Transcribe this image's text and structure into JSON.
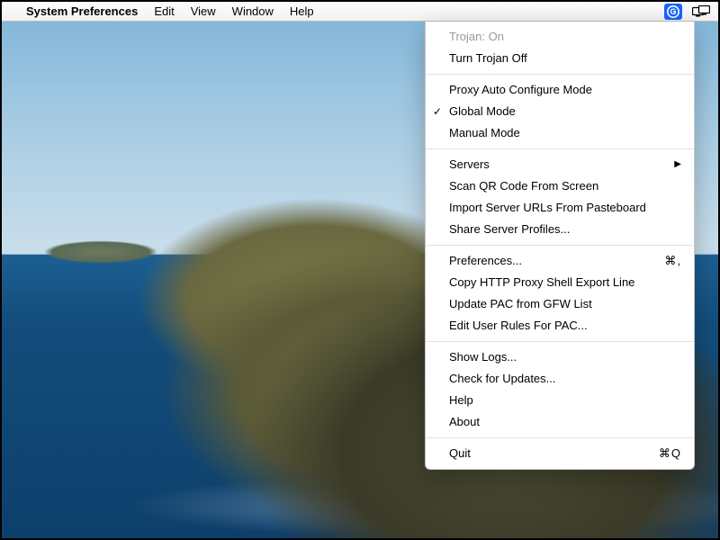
{
  "menubar": {
    "app": "System Preferences",
    "items": [
      "Edit",
      "View",
      "Window",
      "Help"
    ]
  },
  "status_icons": {
    "g_icon": "G",
    "display_icon": "display-mirror"
  },
  "dropdown": {
    "status_label": "Trojan: On",
    "toggle_label": "Turn Trojan Off",
    "modes": {
      "auto": "Proxy Auto Configure Mode",
      "global": "Global Mode",
      "manual": "Manual Mode",
      "selected": "global"
    },
    "servers_label": "Servers",
    "scan_qr": "Scan QR Code From Screen",
    "import_urls": "Import Server URLs From Pasteboard",
    "share_profiles": "Share Server Profiles...",
    "preferences": "Preferences...",
    "preferences_shortcut": "⌘,",
    "copy_proxy": "Copy HTTP Proxy Shell Export Line",
    "update_pac": "Update PAC from GFW List",
    "edit_rules": "Edit User Rules For PAC...",
    "show_logs": "Show Logs...",
    "check_updates": "Check for Updates...",
    "help": "Help",
    "about": "About",
    "quit": "Quit",
    "quit_shortcut": "⌘Q"
  }
}
